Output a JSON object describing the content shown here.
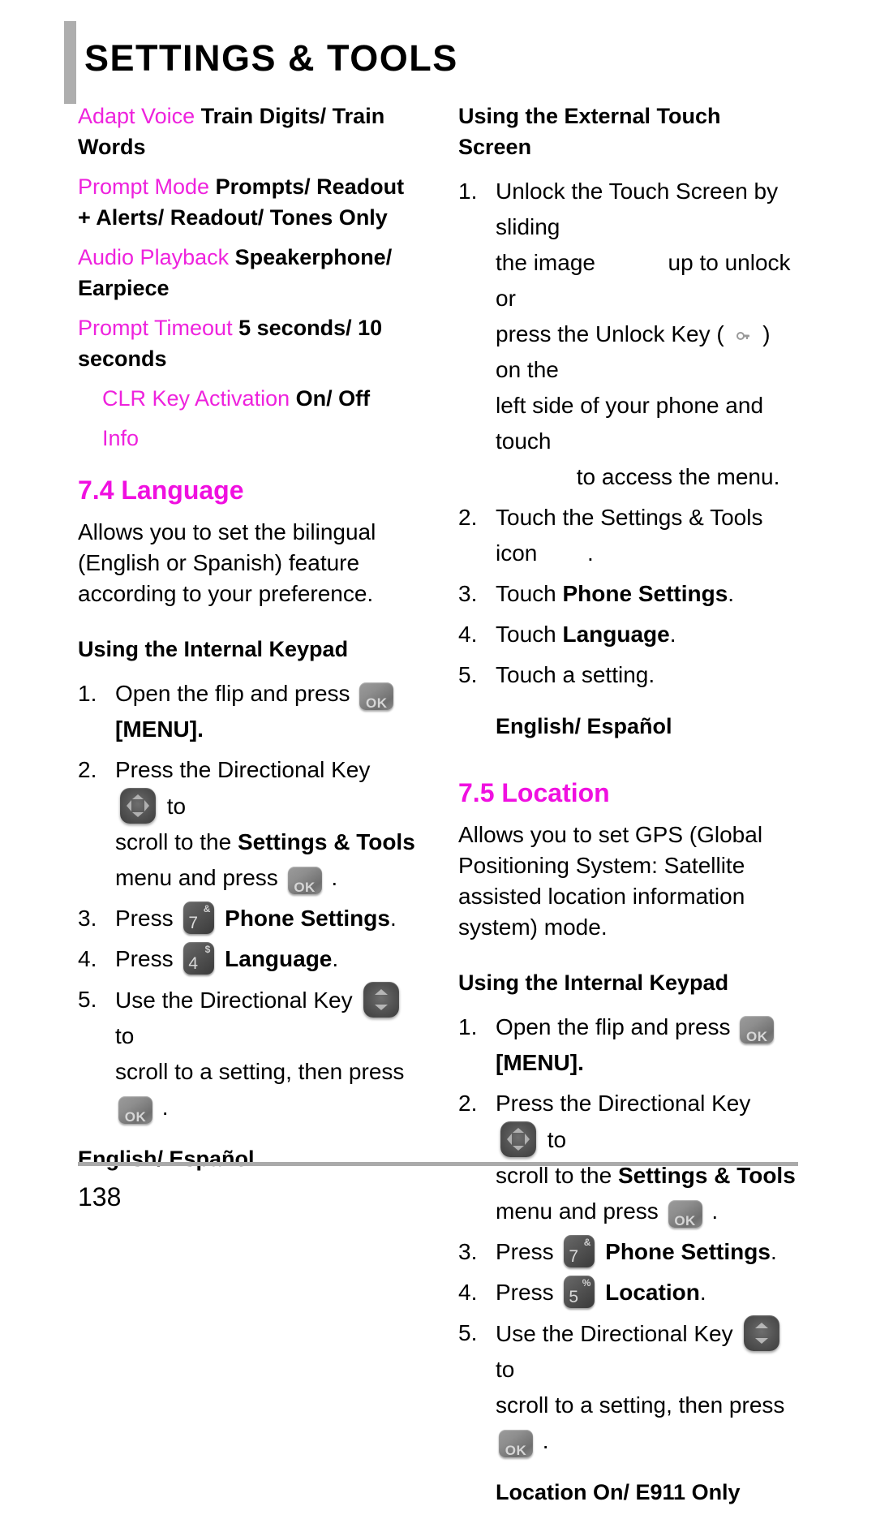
{
  "header": {
    "title": "SETTINGS & TOOLS"
  },
  "left_column": {
    "spec_list": [
      {
        "term": "Adapt Voice",
        "value": "Train Digits/ Train Words"
      },
      {
        "term": "Prompt Mode",
        "value": "Prompts/ Readout + Alerts/ Readout/ Tones Only"
      },
      {
        "term": "Audio Playback",
        "value": "Speakerphone/ Earpiece"
      },
      {
        "term": "Prompt Timeout",
        "value": "5 seconds/ 10 seconds"
      },
      {
        "term": "CLR Key Activation",
        "value": "On/ Off"
      },
      {
        "term": "Info",
        "value": ""
      }
    ],
    "section": {
      "heading": "7.4 Language",
      "body": "Allows you to set the bilingual (English or Spanish) feature according to your preference.",
      "subhead": "Using the Internal Keypad",
      "steps": [
        {
          "num": "1.",
          "before": "Open the flip and press",
          "key": "ok-key",
          "after": "",
          "continuation": "[MENU].",
          "continuation_bold": "[MENU]"
        },
        {
          "num": "2.",
          "before": "Press the Directional Key",
          "key": "directional-key-4way",
          "after": "to",
          "line2_pre": "scroll to the",
          "line2_bold": "Settings & Tools",
          "line3_pre": "menu and press",
          "line3_key": "ok-key",
          "line3_post": "."
        },
        {
          "num": "3.",
          "before": "Press",
          "key": "num-key-7",
          "key_digit": "7",
          "key_sup": "&",
          "bold": "Phone Settings",
          "after": "."
        },
        {
          "num": "4.",
          "before": "Press",
          "key": "num-key-4",
          "key_digit": "4",
          "key_sup": "$",
          "bold": "Language",
          "after": "."
        },
        {
          "num": "5.",
          "before": "Use the Directional Key",
          "key": "directional-key-updown",
          "after": "to",
          "line2_pre": "scroll to a setting, then press",
          "line2_key": "ok-key",
          "line2_post": "."
        }
      ],
      "options": "English/ Español"
    }
  },
  "right_column": {
    "touch_section": {
      "subhead": "Using the External Touch Screen",
      "steps": [
        {
          "num": "1.",
          "line1": "Unlock the Touch Screen by sliding",
          "line2_pre": "the image",
          "line2_post": "up to unlock or",
          "line3_pre": "press the Unlock Key (",
          "line3_key": "unlock-key",
          "line3_post": ") on the",
          "line4": "left side of your phone and touch",
          "line5": "to access the menu."
        },
        {
          "num": "2.",
          "line1": "Touch the Settings & Tools icon",
          "trailing": "."
        },
        {
          "num": "3.",
          "pre": "Touch",
          "bold": "Phone Settings",
          "post": "."
        },
        {
          "num": "4.",
          "pre": "Touch",
          "bold": "Language",
          "post": "."
        },
        {
          "num": "5.",
          "pre": "Touch a setting.",
          "bold": "",
          "post": ""
        }
      ],
      "options": "English/ Español"
    },
    "section": {
      "heading": "7.5 Location",
      "body": "Allows you to set GPS (Global Positioning System: Satellite assisted location information system) mode.",
      "subhead": "Using the Internal Keypad",
      "steps": [
        {
          "num": "1.",
          "before": "Open the flip and press",
          "key": "ok-key",
          "continuation": "[MENU]."
        },
        {
          "num": "2.",
          "before": "Press the Directional Key",
          "key": "directional-key-4way",
          "after": "to",
          "line2_pre": "scroll to the",
          "line2_bold": "Settings & Tools",
          "line3_pre": "menu and press",
          "line3_key": "ok-key",
          "line3_post": "."
        },
        {
          "num": "3.",
          "before": "Press",
          "key": "num-key-7",
          "key_digit": "7",
          "key_sup": "&",
          "bold": "Phone Settings",
          "after": "."
        },
        {
          "num": "4.",
          "before": "Press",
          "key": "num-key-5",
          "key_digit": "5",
          "key_sup": "%",
          "bold": "Location",
          "after": "."
        },
        {
          "num": "5.",
          "before": "Use the Directional Key",
          "key": "directional-key-updown",
          "after": "to",
          "line2_pre": "scroll to a setting, then press",
          "line2_key": "ok-key",
          "line2_post": "."
        }
      ],
      "options": "Location On/ E911 Only"
    }
  },
  "footer": {
    "page_number": "138"
  },
  "colors": {
    "term_magenta": "#ee22dd",
    "heading_magenta": "#f010e0",
    "rule_gray": "#aaaaaa",
    "header_bar_gray": "#aeaeae"
  }
}
